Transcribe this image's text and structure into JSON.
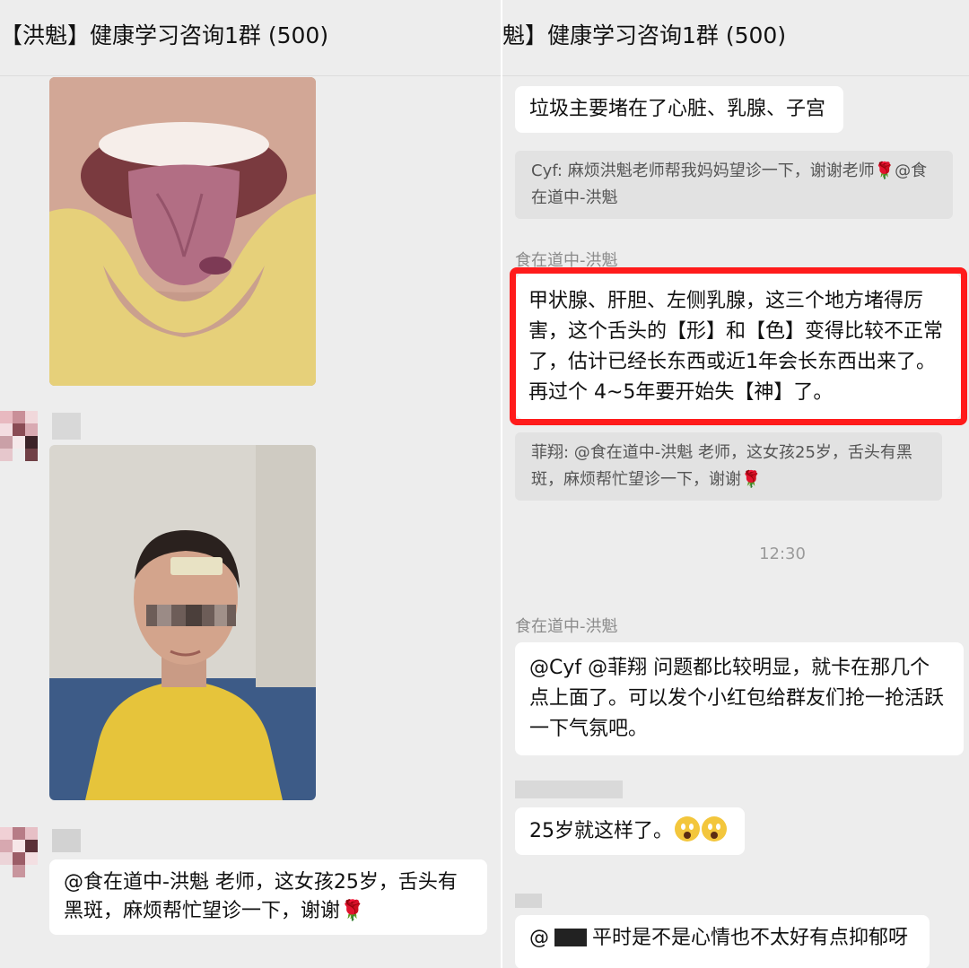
{
  "left_panel": {
    "title": "【洪魁】健康学习咨询1群 (500)",
    "message": "@食在道中-洪魁 老师，这女孩25岁，舌头有黑斑，麻烦帮忙望诊一下，谢谢",
    "message_emoji": "🌹",
    "images": [
      "tongue-photo",
      "face-photo"
    ]
  },
  "right_panel": {
    "title": "魁】健康学习咨询1群 (500)",
    "msg1": "垃圾主要堵在了心脏、乳腺、子宫",
    "quote1": "Cyf: 麻烦洪魁老师帮我妈妈望诊一下，谢谢老师🌹@食在道中-洪魁",
    "sender1": "食在道中-洪魁",
    "msg2": "甲状腺、肝胆、左侧乳腺，这三个地方堵得厉害，这个舌头的【形】和【色】变得比较不正常了，估计已经长东西或近1年会长东西出来了。再过个 4~5年要开始失【神】了。",
    "quote2": "菲翔: @食在道中-洪魁 老师，这女孩25岁，舌头有黑斑，麻烦帮忙望诊一下，谢谢🌹",
    "time": "12:30",
    "sender2": "食在道中-洪魁",
    "msg3": "@Cyf @菲翔 问题都比较明显，就卡在那几个点上面了。可以发个小红包给群友们抢一抢活跃一下气氛吧。",
    "msg4": "25岁就这样了。",
    "msg5_prefix": "@",
    "msg5": "平时是不是心情也不太好有点抑郁呀",
    "highlight_color": "#ff1b1b"
  }
}
